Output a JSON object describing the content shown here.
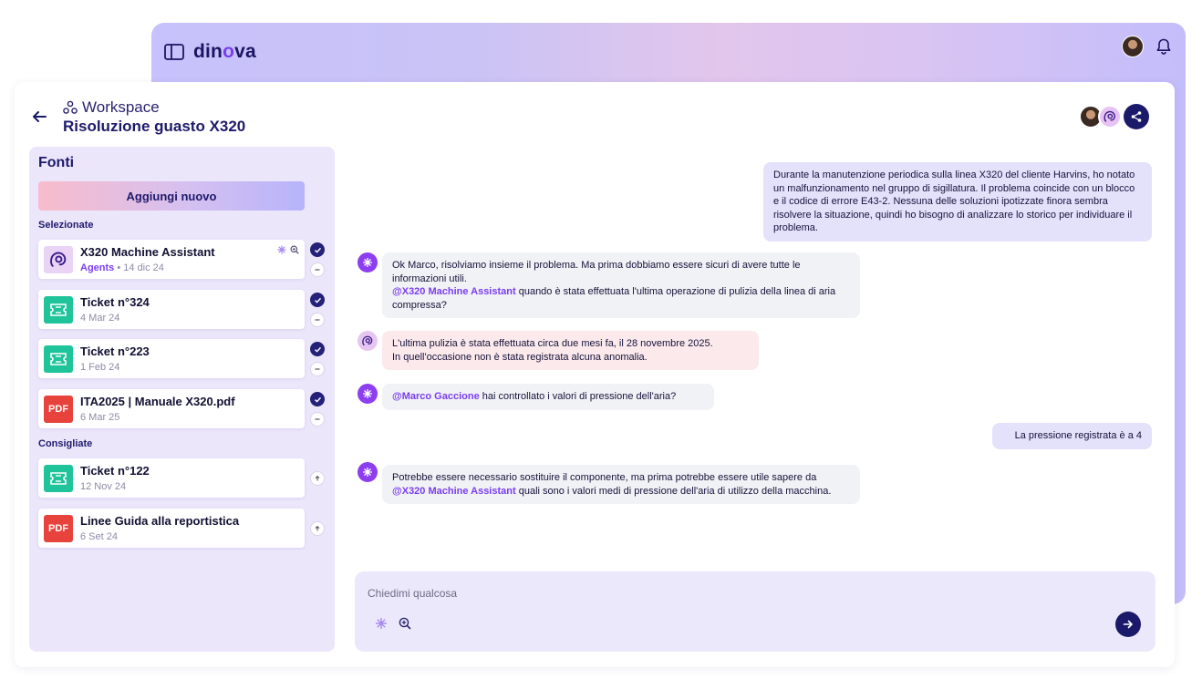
{
  "app": {
    "logo_prefix": "din",
    "logo_o": "o",
    "logo_suffix": "va"
  },
  "header": {
    "workspace_label": "Workspace",
    "title": "Risoluzione guasto X320"
  },
  "sources": {
    "title": "Fonti",
    "add_label": "Aggiungi nuovo",
    "selected_label": "Selezionate",
    "suggested_label": "Consigliate",
    "selected": [
      {
        "title": "X320 Machine Assistant",
        "tag": "Agents",
        "date": "14 dic 24",
        "icon": "agent-icon"
      },
      {
        "title": "Ticket n°324",
        "date": "4 Mar 24",
        "icon": "ticket-icon"
      },
      {
        "title": "Ticket n°223",
        "date": "1 Feb 24",
        "icon": "ticket-icon"
      },
      {
        "title": "ITA2025 | Manuale X320.pdf",
        "date": "6 Mar 25",
        "icon": "pdf-icon",
        "badge": "PDF"
      }
    ],
    "suggested": [
      {
        "title": "Ticket n°122",
        "date": "12 Nov 24",
        "icon": "ticket-icon"
      },
      {
        "title": "Linee Guida alla reportistica",
        "date": "6 Set 24",
        "icon": "pdf-icon",
        "badge": "PDF"
      }
    ]
  },
  "chat": {
    "m1": "Durante la manutenzione periodica sulla linea X320 del cliente Harvins, ho notato un malfunzionamento nel gruppo di sigillatura. Il problema coincide con un blocco e il codice di errore E43-2. Nessuna delle soluzioni ipotizzate finora sembra risolvere la situazione, quindi ho bisogno di analizzare lo storico per individuare il problema.",
    "m2_text": "Ok Marco, risolviamo insieme il problema. Ma prima dobbiamo essere sicuri di avere tutte le informazioni utili.",
    "m2_mention": "@X320 Machine Assistant",
    "m2_after": " quando è stata effettuata l'ultima operazione di pulizia della linea di aria compressa?",
    "m3_line1": "L'ultima pulizia è stata effettuata circa due mesi fa, il 28 novembre 2025.",
    "m3_line2": "In quell'occasione non è stata registrata alcuna anomalia.",
    "m4_mention": "@Marco Gaccione",
    "m4_after": " hai controllato i valori di pressione dell'aria?",
    "m5": "La pressione registrata è a 4",
    "m6_before": "Potrebbe essere necessario sostituire il componente, ma prima potrebbe essere utile sapere da ",
    "m6_mention": "@X320 Machine Assistant",
    "m6_after": " quali sono i valori medi di pressione dell'aria di utilizzo della macchina."
  },
  "composer": {
    "placeholder": "Chiedimi qualcosa"
  },
  "colors": {
    "accent": "#7b3df2",
    "navy": "#1b1a6a",
    "ticket": "#1fc49a",
    "pdf": "#e7423b"
  }
}
